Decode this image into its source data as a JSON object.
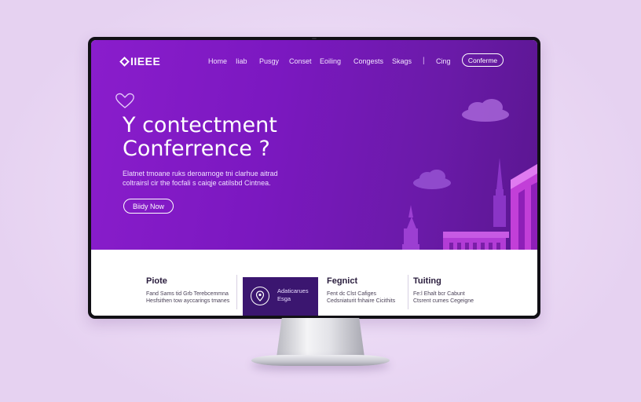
{
  "nav": {
    "logo": "IIEEE",
    "links": [
      "Home",
      "Iiab",
      "Pusgy",
      "Conset",
      "Eoiling",
      "Congests",
      "Skags"
    ],
    "signin": "Cing",
    "cta": "Conferme"
  },
  "hero": {
    "title_line1": "Y contectment",
    "title_line2": "Conferrence ?",
    "desc_line1": "Elatnet tmoane ruks deroarnoge tni clarhue aitrad",
    "desc_line2": "coltrairsl cir the focfali s caiqje catilsbd Cintnea.",
    "button": "Biidy Now"
  },
  "features": [
    {
      "title": "Piote",
      "desc_line1": "Fand Sams tid Grb Terebcemmna",
      "desc_line2": "Hesfsithen tow ayccarings tmanes"
    },
    {
      "title": "Adaticarues",
      "desc_line2": "Esga",
      "icon": "map-pin-icon"
    },
    {
      "title": "Fegnict",
      "desc_line1": "Fent dc Clst Cafiges",
      "desc_line2": "Cedsniaturit fnhaire Cicithits"
    },
    {
      "title": "Tuiting",
      "desc_line1": "Fe:l Ehalt bcr Cabunt",
      "desc_line2": "Ctsrent cumes Cegeigne"
    }
  ],
  "colors": {
    "hero_purple": "#7b18c0",
    "active_tile": "#3b1670",
    "building_pink": "#c23fd8"
  }
}
